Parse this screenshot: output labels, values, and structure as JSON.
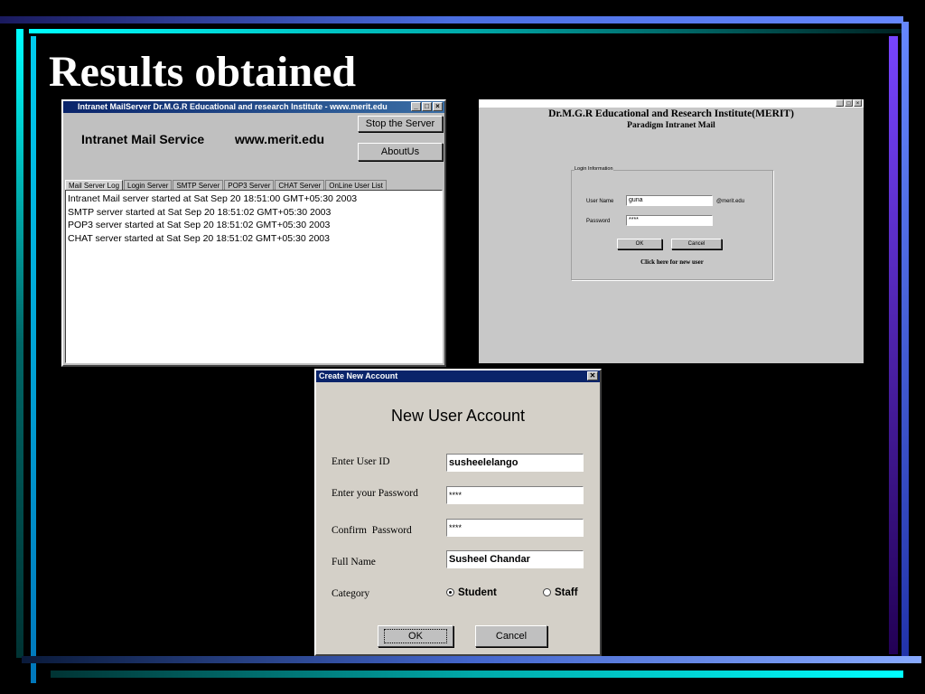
{
  "slide": {
    "title": "Results obtained"
  },
  "server_window": {
    "titlebar": "Intranet MailServer Dr.M.G.R Educational and research Institute - www.merit.edu",
    "service_label": "Intranet Mail Service",
    "domain_label": "www.merit.edu",
    "stop_button": "Stop the Server",
    "about_button": "AboutUs",
    "tabs": [
      "Mail Server Log",
      "Login Server",
      "SMTP Server",
      "POP3 Server",
      "CHAT Server",
      "OnLine User List"
    ],
    "log_lines": [
      "Intranet Mail server started at Sat Sep 20 18:51:00 GMT+05:30 2003",
      "SMTP server started at Sat Sep 20 18:51:02 GMT+05:30 2003",
      "POP3 server started at Sat Sep 20 18:51:02 GMT+05:30 2003",
      "CHAT server started at Sat Sep 20 18:51:02 GMT+05:30 2003"
    ]
  },
  "login_window": {
    "heading": "Dr.M.G.R Educational and Research Institute(MERIT)",
    "subheading": "Paradigm Intranet Mail",
    "group_label": "Login Information",
    "username_label": "User Name",
    "username_value": "guna",
    "domain_suffix": "@merit.edu",
    "password_label": "Password",
    "password_value": "****",
    "ok_button": "OK",
    "cancel_button": "Cancel",
    "new_user_link": "Click here for new user"
  },
  "account_window": {
    "titlebar": "Create New Account",
    "close_glyph": "✕",
    "heading": "New User Account",
    "user_id_label": "Enter User ID",
    "user_id_value": "susheelelango",
    "password_label": "Enter your Password",
    "password_value": "****",
    "confirm_label": "Confirm  Password",
    "confirm_value": "****",
    "fullname_label": "Full Name",
    "fullname_value": "Susheel Chandar",
    "category_label": "Category",
    "category_options": [
      "Student",
      "Staff"
    ],
    "category_selected": "Student",
    "ok_button": "OK",
    "cancel_button": "Cancel"
  }
}
